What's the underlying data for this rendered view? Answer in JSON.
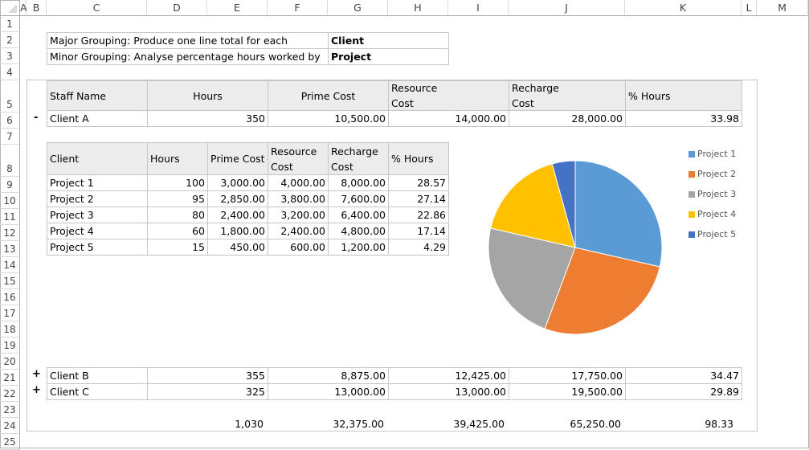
{
  "columns": [
    "A",
    "B",
    "C",
    "D",
    "E",
    "F",
    "G",
    "H",
    "I",
    "J",
    "K",
    "L",
    "M"
  ],
  "rows": [
    "1",
    "2",
    "3",
    "4",
    "5",
    "6",
    "7",
    "8",
    "9",
    "10",
    "11",
    "12",
    "13",
    "14",
    "15",
    "16",
    "17",
    "18",
    "19",
    "20",
    "21",
    "22",
    "23",
    "24",
    "25"
  ],
  "grouping": {
    "major_label": "Major Grouping: Produce one line total for each",
    "major_value": "Client",
    "minor_label": "Minor Grouping: Analyse percentage hours worked by",
    "minor_value": "Project"
  },
  "summary": {
    "headers": {
      "name": "Staff Name",
      "hours": "Hours",
      "prime": "Prime Cost",
      "resource_1": "Resource",
      "resource_2": "Cost",
      "recharge_1": "Recharge",
      "recharge_2": "Cost",
      "pct": "% Hours"
    },
    "clients": [
      {
        "toggle": "-",
        "name": "Client A",
        "hours": "350",
        "prime": "10,500.00",
        "resource": "14,000.00",
        "recharge": "28,000.00",
        "pct": "33.98"
      },
      {
        "toggle": "+",
        "name": "Client B",
        "hours": "355",
        "prime": "8,875.00",
        "resource": "12,425.00",
        "recharge": "17,750.00",
        "pct": "34.47"
      },
      {
        "toggle": "+",
        "name": "Client C",
        "hours": "325",
        "prime": "13,000.00",
        "resource": "13,000.00",
        "recharge": "19,500.00",
        "pct": "29.89"
      }
    ],
    "totals": {
      "hours": "1,030",
      "prime": "32,375.00",
      "resource": "39,425.00",
      "recharge": "65,250.00",
      "pct": "98.33"
    }
  },
  "detail": {
    "headers": {
      "client": "Client",
      "hours": "Hours",
      "prime": "Prime Cost",
      "resource_1": "Resource",
      "resource_2": "Cost",
      "recharge_1": "Recharge",
      "recharge_2": "Cost",
      "pct": "% Hours"
    },
    "rows": [
      {
        "name": "Project 1",
        "hours": "100",
        "prime": "3,000.00",
        "resource": "4,000.00",
        "recharge": "8,000.00",
        "pct": "28.57"
      },
      {
        "name": "Project 2",
        "hours": "95",
        "prime": "2,850.00",
        "resource": "3,800.00",
        "recharge": "7,600.00",
        "pct": "27.14"
      },
      {
        "name": "Project 3",
        "hours": "80",
        "prime": "2,400.00",
        "resource": "3,200.00",
        "recharge": "6,400.00",
        "pct": "22.86"
      },
      {
        "name": "Project 4",
        "hours": "60",
        "prime": "1,800.00",
        "resource": "2,400.00",
        "recharge": "4,800.00",
        "pct": "17.14"
      },
      {
        "name": "Project 5",
        "hours": "15",
        "prime": "450.00",
        "resource": "600.00",
        "recharge": "1,200.00",
        "pct": "4.29"
      }
    ]
  },
  "chart_data": {
    "type": "pie",
    "title": "",
    "categories": [
      "Project 1",
      "Project 2",
      "Project 3",
      "Project 4",
      "Project 5"
    ],
    "values": [
      28.57,
      27.14,
      22.86,
      17.14,
      4.29
    ],
    "colors": [
      "#5b9bd5",
      "#ed7d31",
      "#a5a5a5",
      "#ffc000",
      "#4472c4"
    ],
    "legend": "right"
  }
}
